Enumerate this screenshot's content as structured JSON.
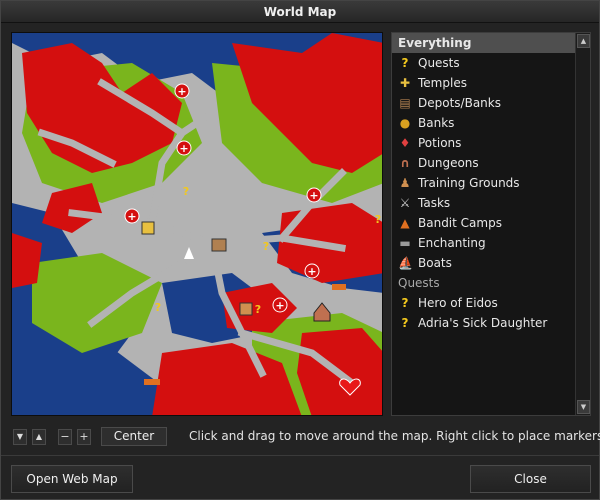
{
  "window": {
    "title": "World Map"
  },
  "map": {
    "hint": "Click and drag to move around the map. Right click to place markers."
  },
  "controls": {
    "down_arrow": "▼",
    "up_arrow": "▲",
    "zoom_out": "−",
    "zoom_in": "+",
    "center_label": "Center"
  },
  "legend": {
    "header": "Everything",
    "items": [
      {
        "label": "Quests",
        "icon": "quest-icon",
        "glyph": "?",
        "color": "#f2c81e"
      },
      {
        "label": "Temples",
        "icon": "temple-icon",
        "glyph": "✚",
        "color": "#e8c040"
      },
      {
        "label": "Depots/Banks",
        "icon": "depot-icon",
        "glyph": "▤",
        "color": "#b08050"
      },
      {
        "label": "Banks",
        "icon": "bank-icon",
        "glyph": "●",
        "color": "#d8a020"
      },
      {
        "label": "Potions",
        "icon": "potion-icon",
        "glyph": "♦",
        "color": "#e04040"
      },
      {
        "label": "Dungeons",
        "icon": "dungeon-icon",
        "glyph": "∩",
        "color": "#c07050"
      },
      {
        "label": "Training Grounds",
        "icon": "training-icon",
        "glyph": "♟",
        "color": "#d09050"
      },
      {
        "label": "Tasks",
        "icon": "task-icon",
        "glyph": "⚔",
        "color": "#cccccc"
      },
      {
        "label": "Bandit Camps",
        "icon": "bandit-camp-icon",
        "glyph": "▲",
        "color": "#e07020"
      },
      {
        "label": "Enchanting",
        "icon": "enchanting-icon",
        "glyph": "▬",
        "color": "#9a9a9a"
      },
      {
        "label": "Boats",
        "icon": "boat-icon",
        "glyph": "⛵",
        "color": "#e8e8e8"
      }
    ],
    "quests_section": "Quests",
    "quests": [
      {
        "label": "Hero of Eidos",
        "glyph": "?",
        "color": "#f2c81e"
      },
      {
        "label": "Adria's Sick Daughter",
        "glyph": "?",
        "color": "#f2c81e"
      }
    ],
    "scroll_up": "▲",
    "scroll_down": "▼"
  },
  "buttons": {
    "open_web_map": "Open Web Map",
    "close": "Close"
  },
  "colors": {
    "water": "#1a3f8a",
    "lava": "#d40f0f",
    "grass": "#7ab51d",
    "road": "#b3b3b3"
  }
}
